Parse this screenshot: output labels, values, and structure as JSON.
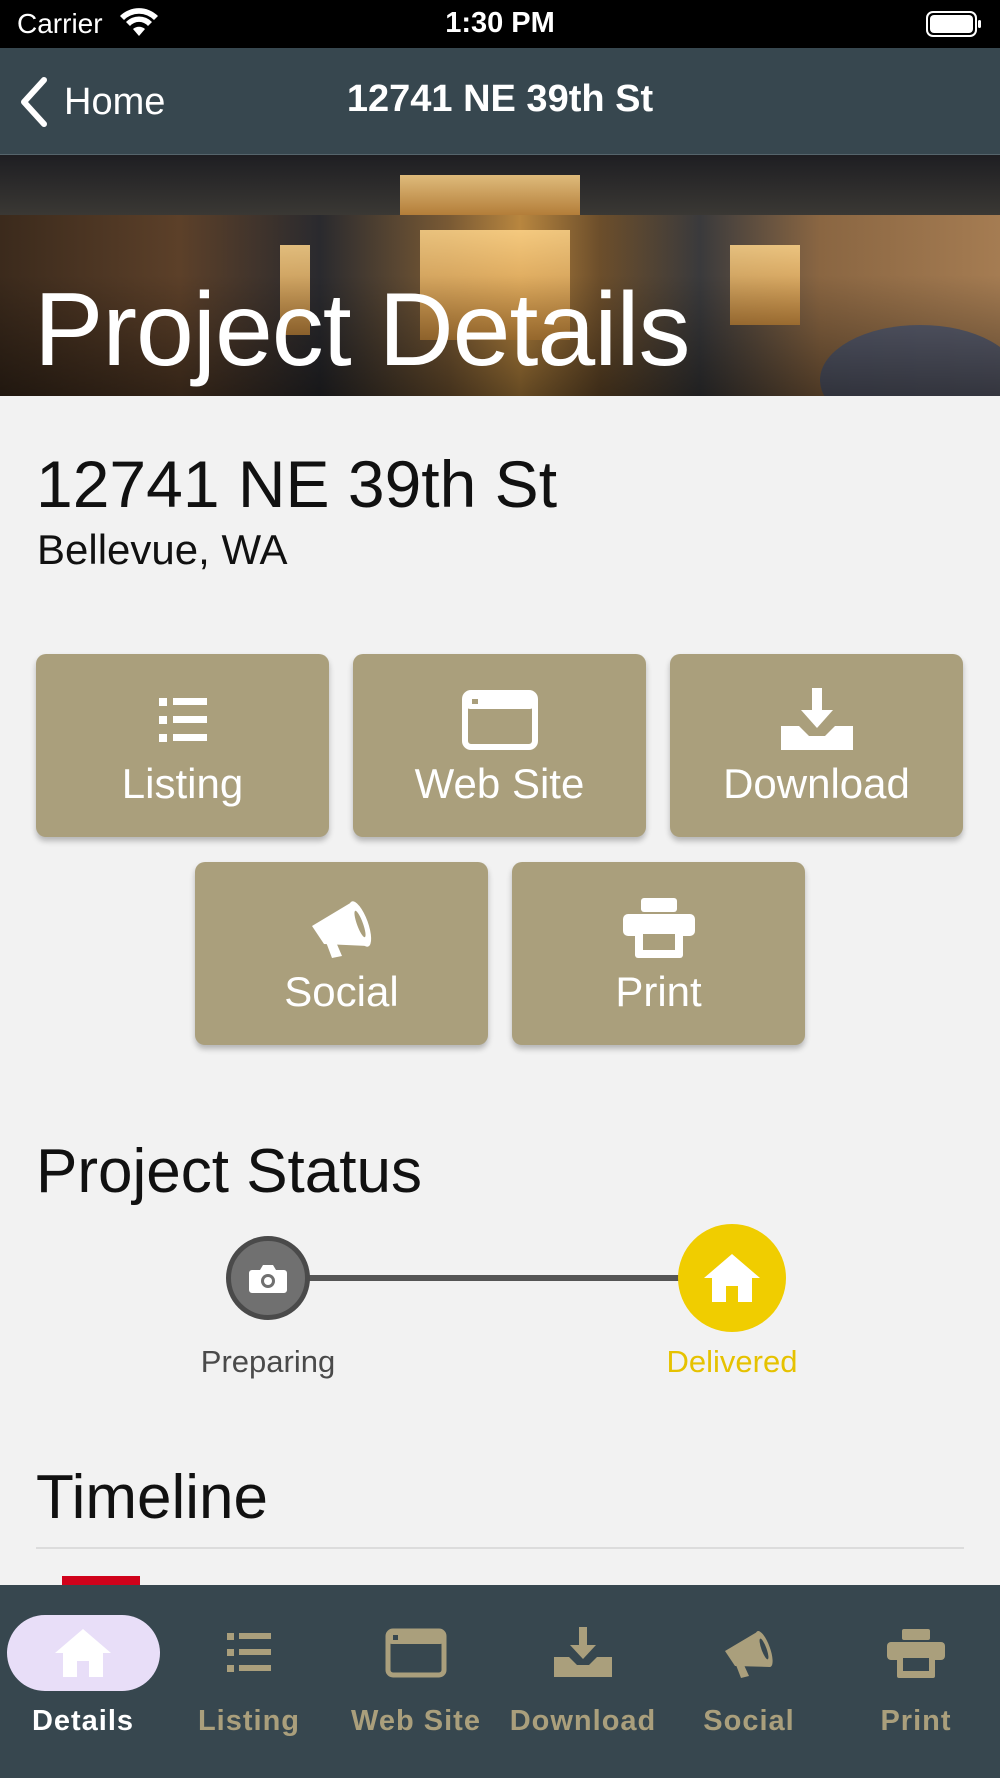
{
  "status_bar": {
    "carrier": "Carrier",
    "time": "1:30 PM"
  },
  "nav": {
    "back_label": "Home",
    "title": "12741 NE 39th St"
  },
  "hero": {
    "title": "Project Details"
  },
  "address": {
    "street": "12741 NE 39th St",
    "city": "Bellevue, WA"
  },
  "actions": [
    {
      "label": "Listing",
      "icon": "list-icon"
    },
    {
      "label": "Web Site",
      "icon": "browser-window-icon"
    },
    {
      "label": "Download",
      "icon": "download-tray-icon"
    },
    {
      "label": "Social",
      "icon": "megaphone-icon"
    },
    {
      "label": "Print",
      "icon": "printer-icon"
    }
  ],
  "project_status": {
    "title": "Project Status",
    "steps": [
      {
        "label": "Preparing",
        "icon": "camera-icon",
        "state": "complete"
      },
      {
        "label": "Delivered",
        "icon": "home-icon",
        "state": "current"
      }
    ],
    "colors": {
      "current": "#f0cd00",
      "complete": "#707070"
    }
  },
  "timeline": {
    "title": "Timeline"
  },
  "tab_bar": {
    "active_index": 0,
    "tabs": [
      {
        "label": "Details",
        "icon": "home-icon"
      },
      {
        "label": "Listing",
        "icon": "list-icon"
      },
      {
        "label": "Web Site",
        "icon": "browser-window-icon"
      },
      {
        "label": "Download",
        "icon": "download-tray-icon"
      },
      {
        "label": "Social",
        "icon": "megaphone-icon"
      },
      {
        "label": "Print",
        "icon": "printer-icon"
      }
    ],
    "colors": {
      "active_label": "#ffffff",
      "inactive": "#aa9f7c",
      "active_pill": "#e8def8"
    }
  },
  "colors": {
    "accent_tile": "#aa9f7c",
    "nav_bg": "#37474f"
  }
}
